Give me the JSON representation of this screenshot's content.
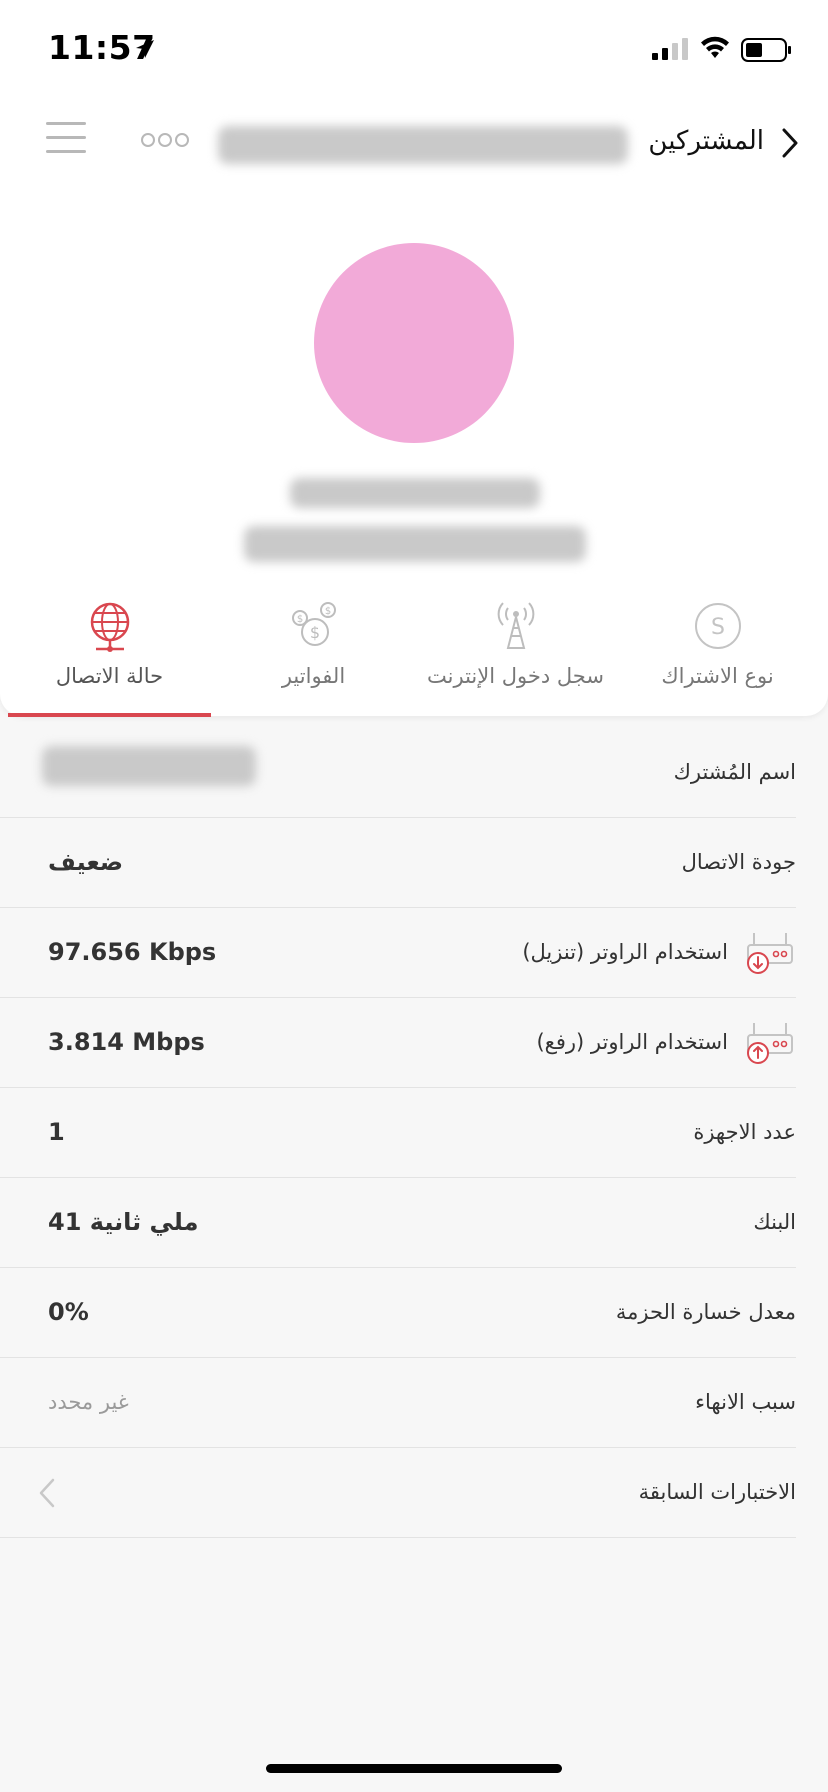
{
  "status_bar": {
    "time": "11:57"
  },
  "header": {
    "back_label": "المشتركين"
  },
  "tabs": [
    {
      "label": "حالة الاتصال",
      "icon": "globe-network-icon",
      "active": true
    },
    {
      "label": "الفواتير",
      "icon": "coins-icon",
      "active": false
    },
    {
      "label": "سجل دخول الإنترنت",
      "icon": "antenna-icon",
      "active": false
    },
    {
      "label": "نوع الاشتراك",
      "icon": "subscription-s-icon",
      "active": false
    }
  ],
  "rows": {
    "subscriber_name": {
      "label": "اسم المُشترك"
    },
    "quality": {
      "label": "جودة الاتصال",
      "value": "ضعيف"
    },
    "download": {
      "label": "استخدام الراوتر (تنزيل)",
      "value": "97.656 Kbps",
      "icon": "router-download-icon"
    },
    "upload": {
      "label": "استخدام الراوتر (رفع)",
      "value": "3.814 Mbps",
      "icon": "router-upload-icon"
    },
    "devices": {
      "label": "عدد الاجهزة",
      "value": "1"
    },
    "ping": {
      "label": "البنك",
      "value": "41 ملي ثانية"
    },
    "packet_loss": {
      "label": "معدل خسارة الحزمة",
      "value": "0%"
    },
    "end_reason": {
      "label": "سبب الانهاء",
      "value": "غير محدد"
    },
    "previous_tests": {
      "label": "الاختبارات السابقة"
    }
  },
  "colors": {
    "accent": "#d9474f",
    "avatar": "#f2aad8"
  }
}
